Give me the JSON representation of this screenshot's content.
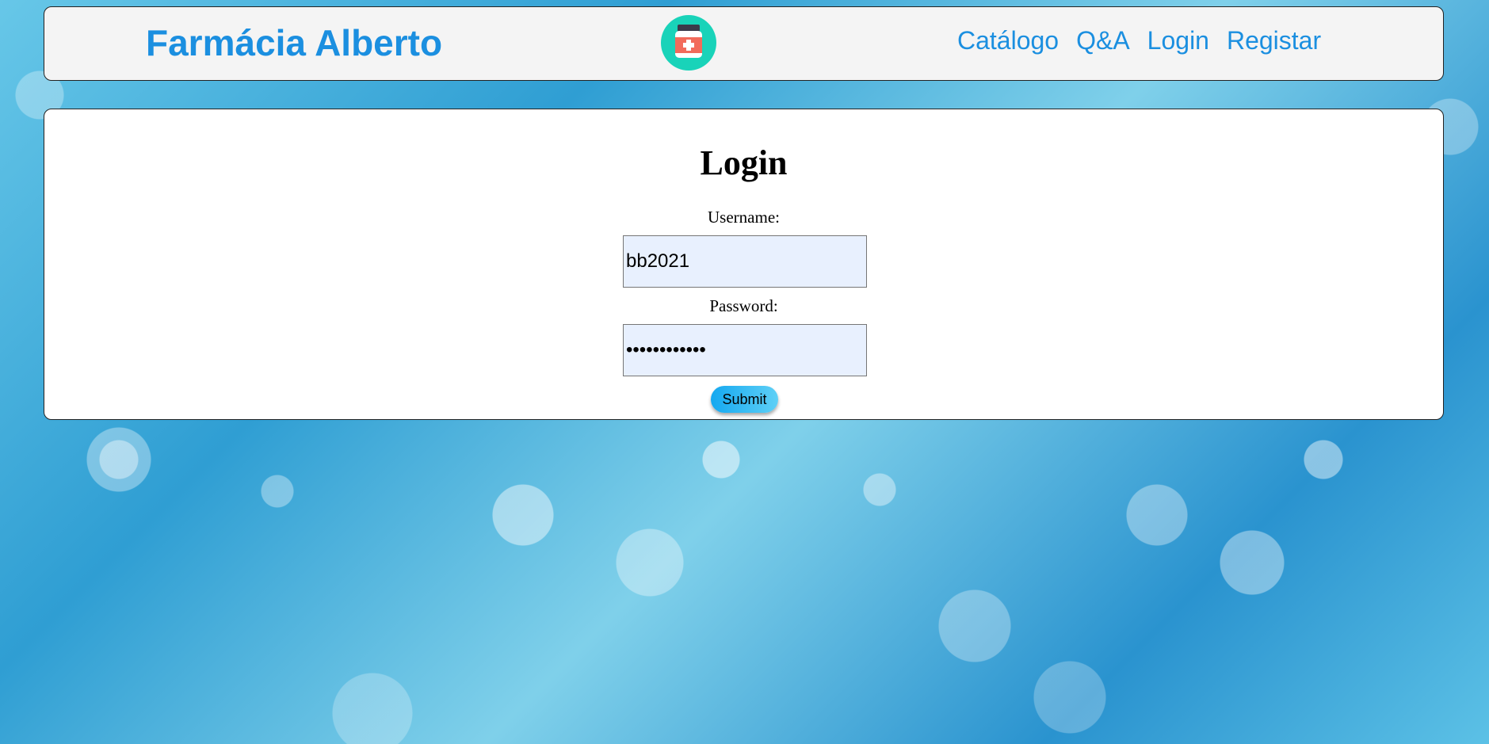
{
  "header": {
    "brand": "Farmácia Alberto",
    "logo_icon": "medicine-bottle-icon",
    "nav": [
      {
        "label": "Catálogo"
      },
      {
        "label": "Q&A"
      },
      {
        "label": "Login"
      },
      {
        "label": "Registar"
      }
    ]
  },
  "login": {
    "title": "Login",
    "username_label": "Username:",
    "username_value": "bb2021",
    "password_label": "Password:",
    "password_value": "bb2021bb2021",
    "submit_label": "Submit"
  },
  "colors": {
    "brand": "#1b8fe0",
    "logo_circle": "#19d3b9",
    "logo_cross": "#f26b5b",
    "input_bg": "#e8f0fe",
    "button_start": "#14a8f0",
    "button_end": "#5fd0f6"
  }
}
